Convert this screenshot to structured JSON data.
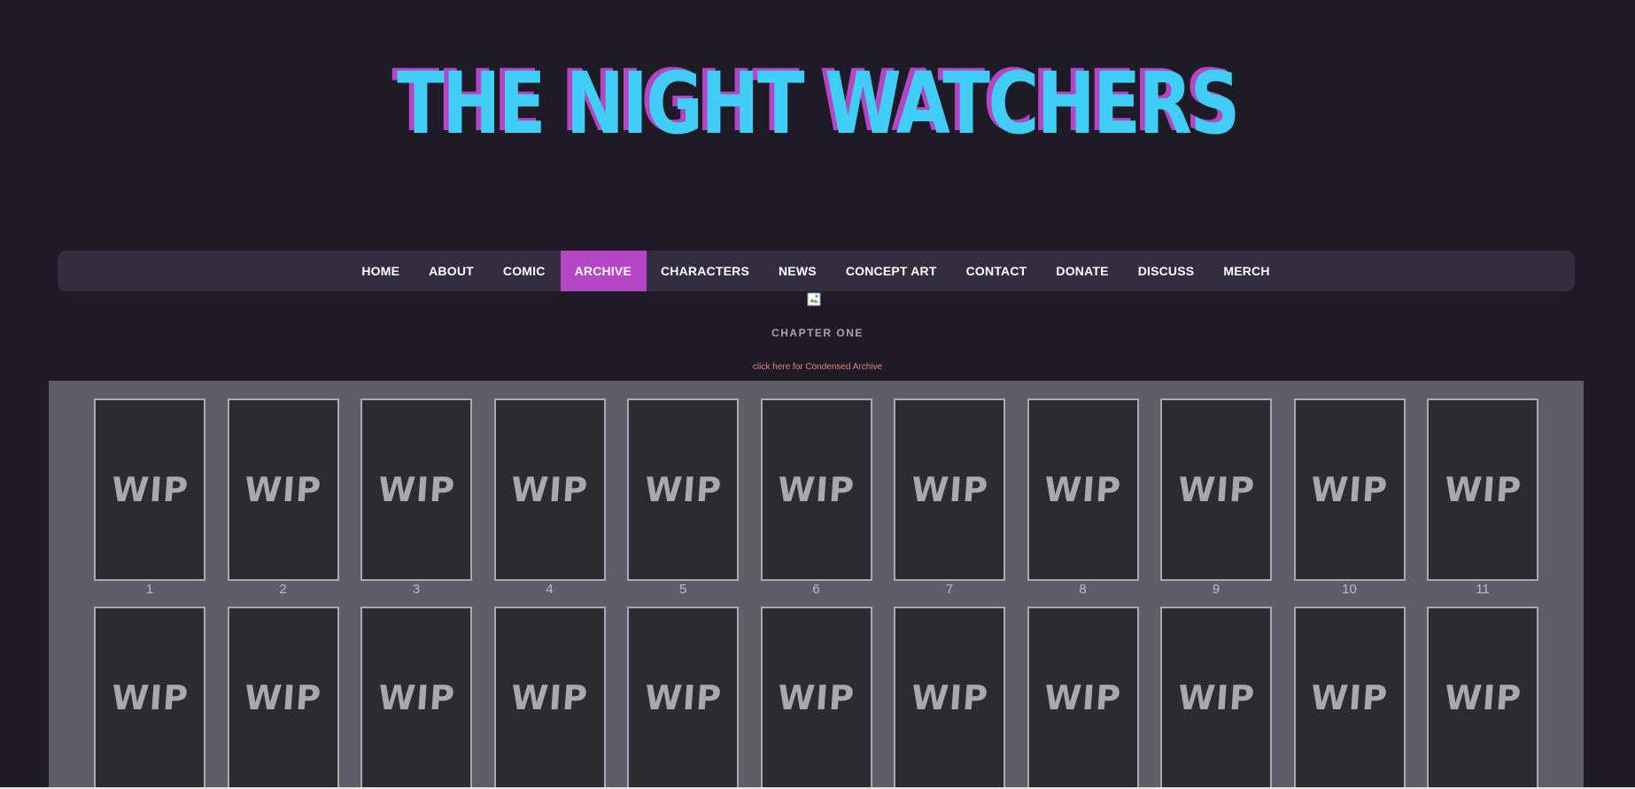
{
  "site": {
    "title": "THE NIGHT WATCHERS"
  },
  "nav": {
    "items": [
      {
        "label": "HOME",
        "name": "home"
      },
      {
        "label": "ABOUT",
        "name": "about"
      },
      {
        "label": "COMIC",
        "name": "comic"
      },
      {
        "label": "ARCHIVE",
        "name": "archive",
        "active": true
      },
      {
        "label": "CHARACTERS",
        "name": "characters"
      },
      {
        "label": "NEWS",
        "name": "news"
      },
      {
        "label": "CONCEPT ART",
        "name": "concept-art"
      },
      {
        "label": "CONTACT",
        "name": "contact"
      },
      {
        "label": "DONATE",
        "name": "donate"
      },
      {
        "label": "DISCUSS",
        "name": "discuss"
      },
      {
        "label": "MERCH",
        "name": "merch"
      }
    ]
  },
  "archive": {
    "chapter_title": "CHAPTER ONE",
    "condensed_link": "click here for Condensed Archive",
    "pages": [
      {
        "thumb_text": "WIP",
        "number": "1"
      },
      {
        "thumb_text": "WIP",
        "number": "2"
      },
      {
        "thumb_text": "WIP",
        "number": "3"
      },
      {
        "thumb_text": "WIP",
        "number": "4"
      },
      {
        "thumb_text": "WIP",
        "number": "5"
      },
      {
        "thumb_text": "WIP",
        "number": "6"
      },
      {
        "thumb_text": "WIP",
        "number": "7"
      },
      {
        "thumb_text": "WIP",
        "number": "8"
      },
      {
        "thumb_text": "WIP",
        "number": "9"
      },
      {
        "thumb_text": "WIP",
        "number": "10"
      },
      {
        "thumb_text": "WIP",
        "number": "11"
      },
      {
        "thumb_text": "WIP",
        "number": ""
      },
      {
        "thumb_text": "WIP",
        "number": ""
      },
      {
        "thumb_text": "WIP",
        "number": ""
      },
      {
        "thumb_text": "WIP",
        "number": ""
      },
      {
        "thumb_text": "WIP",
        "number": ""
      },
      {
        "thumb_text": "WIP",
        "number": ""
      },
      {
        "thumb_text": "WIP",
        "number": ""
      },
      {
        "thumb_text": "WIP",
        "number": ""
      },
      {
        "thumb_text": "WIP",
        "number": ""
      },
      {
        "thumb_text": "WIP",
        "number": ""
      },
      {
        "thumb_text": "WIP",
        "number": ""
      }
    ]
  },
  "colors": {
    "background": "#1e1b26",
    "title_cyan": "#40cdf6",
    "title_shadow_magenta": "#b446c6",
    "nav_bar": "#322e40",
    "nav_active": "#b446c6",
    "archive_panel": "#5e5d68",
    "link": "#e0837f"
  },
  "icons": {
    "chapter_banner": "broken-image-icon"
  }
}
